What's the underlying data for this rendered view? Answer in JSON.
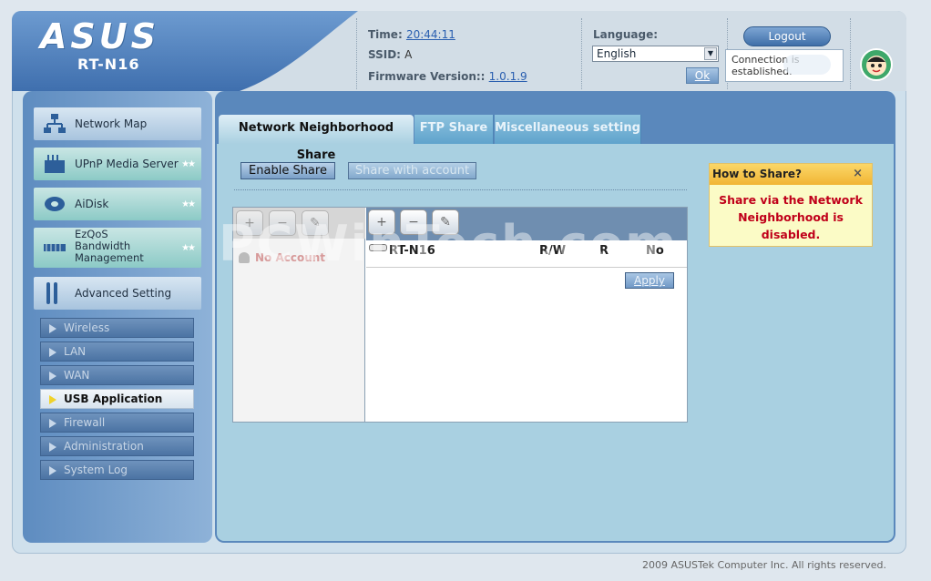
{
  "brand": {
    "logo": "ASUS",
    "model": "RT-N16"
  },
  "status": {
    "time_label": "Time:",
    "time_value": "20:44:11",
    "ssid_label": "SSID:",
    "ssid_value": "A",
    "firmware_label": "Firmware Version::",
    "firmware_value": "1.0.1.9"
  },
  "language": {
    "label": "Language:",
    "selected": "English",
    "ok_label": "Ok"
  },
  "session": {
    "logout_label": "Logout",
    "connection_text": "Connection is established."
  },
  "sidebar": {
    "main_items": [
      {
        "label": "Network Map",
        "icon": "network-map-icon"
      },
      {
        "label": "UPnP Media Server",
        "icon": "media-server-icon"
      },
      {
        "label": "AiDisk",
        "icon": "aidisk-icon"
      },
      {
        "label": "EzQoS Bandwidth Management",
        "icon": "qos-icon"
      },
      {
        "label": "Advanced Setting",
        "icon": "wrench-icon"
      }
    ],
    "sub_items": [
      {
        "label": "Wireless"
      },
      {
        "label": "LAN"
      },
      {
        "label": "WAN"
      },
      {
        "label": "USB Application",
        "active": true
      },
      {
        "label": "Firewall"
      },
      {
        "label": "Administration"
      },
      {
        "label": "System Log"
      }
    ]
  },
  "tabs": [
    {
      "label": "Network Neighborhood Share",
      "active": true
    },
    {
      "label": "FTP Share"
    },
    {
      "label": "Miscellaneous setting"
    }
  ],
  "share": {
    "enable_label": "Enable Share",
    "with_account_label": "Share with account",
    "no_account_label": "No Account",
    "columns": {
      "drive": "RT-N16",
      "rw": "R/W",
      "r": "R",
      "no": "No"
    },
    "apply_label": "Apply"
  },
  "help": {
    "title": "How to Share?",
    "close": "×",
    "body": "Share via the Network Neighborhood is disabled."
  },
  "watermark": "PCWinTech.com",
  "footer": "2009 ASUSTek Computer Inc. All rights reserved.",
  "colors": {
    "accent": "#5a88bc",
    "panel": "#a9d0e1",
    "help_text": "#c0001a"
  }
}
